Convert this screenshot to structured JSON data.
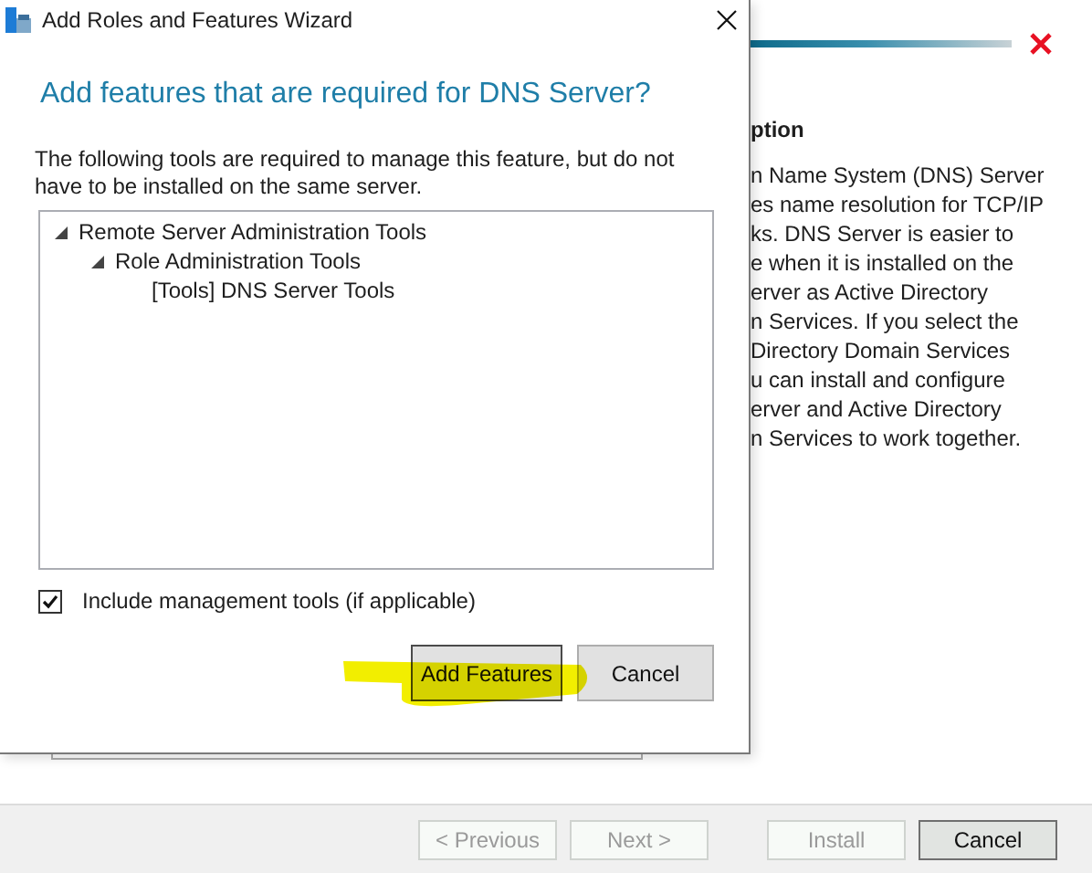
{
  "background": {
    "section_heading": "ption",
    "description_lines": [
      "n Name System (DNS) Server",
      "es name resolution for TCP/IP",
      "ks. DNS Server is easier to",
      "e when it is installed on the",
      "erver as Active Directory",
      "n Services. If you select the",
      "Directory Domain Services",
      "u can install and configure",
      "erver and Active Directory",
      "n Services to work together."
    ],
    "buttons": [
      {
        "label": "< Previous",
        "disabled": true
      },
      {
        "label": "Next >",
        "disabled": true
      },
      {
        "label": "Install",
        "disabled": true
      },
      {
        "label": "Cancel",
        "disabled": false
      }
    ]
  },
  "dialog": {
    "title": "Add Roles and Features Wizard",
    "heading": "Add features that are required for DNS Server?",
    "description": "The following tools are required to manage this feature, but do not have to be installed on the same server.",
    "tree": [
      {
        "label": "Remote Server Administration Tools",
        "expanded": true,
        "children": [
          {
            "label": "Role Administration Tools",
            "expanded": true,
            "children": [
              {
                "label": "[Tools] DNS Server Tools"
              }
            ]
          }
        ]
      }
    ],
    "include_tools": {
      "label": "Include management tools (if applicable)",
      "checked": true
    },
    "buttons": [
      {
        "label": "Add Features",
        "default": true
      },
      {
        "label": "Cancel",
        "default": false
      }
    ]
  }
}
